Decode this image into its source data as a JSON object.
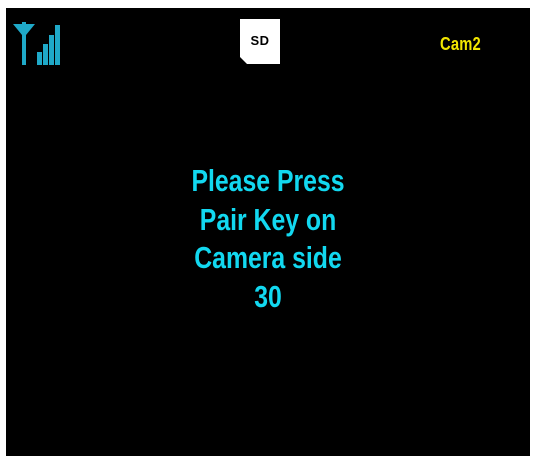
{
  "status_bar": {
    "signal_icon": "signal-strength-icon",
    "sd_card": {
      "icon": "sd-card-icon",
      "label": "SD"
    },
    "camera_label": "Cam2"
  },
  "message": {
    "lines": [
      "Please Press",
      "Pair Key on",
      "Camera side"
    ],
    "countdown": "30"
  },
  "colors": {
    "background": "#000000",
    "message_text": "#12d8f0",
    "camera_label": "#f2e600",
    "signal_icon": "#1fa9c8",
    "sd_card": "#ffffff"
  }
}
